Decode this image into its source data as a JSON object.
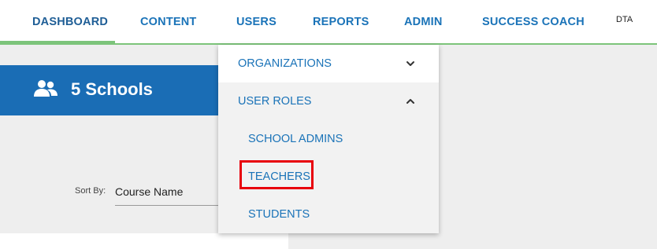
{
  "nav": {
    "items": [
      {
        "label": "DASHBOARD"
      },
      {
        "label": "CONTENT"
      },
      {
        "label": "USERS"
      },
      {
        "label": "REPORTS"
      },
      {
        "label": "ADMIN"
      },
      {
        "label": "SUCCESS COACH"
      }
    ],
    "user": "DTA"
  },
  "banner": {
    "icon": "users-icon",
    "title": "5 Schools"
  },
  "sort": {
    "label": "Sort By:",
    "value": "Course Name"
  },
  "dropdown": {
    "items": [
      {
        "label": "ORGANIZATIONS",
        "icon": "chevron-down-icon"
      },
      {
        "label": "USER ROLES",
        "icon": "chevron-up-icon"
      },
      {
        "label": "SCHOOL ADMINS"
      },
      {
        "label": "TEACHERS",
        "highlighted": true
      },
      {
        "label": "STUDENTS"
      }
    ]
  },
  "colors": {
    "nav_text": "#1a73b8",
    "active_underline": "#7cc47a",
    "banner_bg": "#1a6db5",
    "highlight": "#e8000b"
  }
}
